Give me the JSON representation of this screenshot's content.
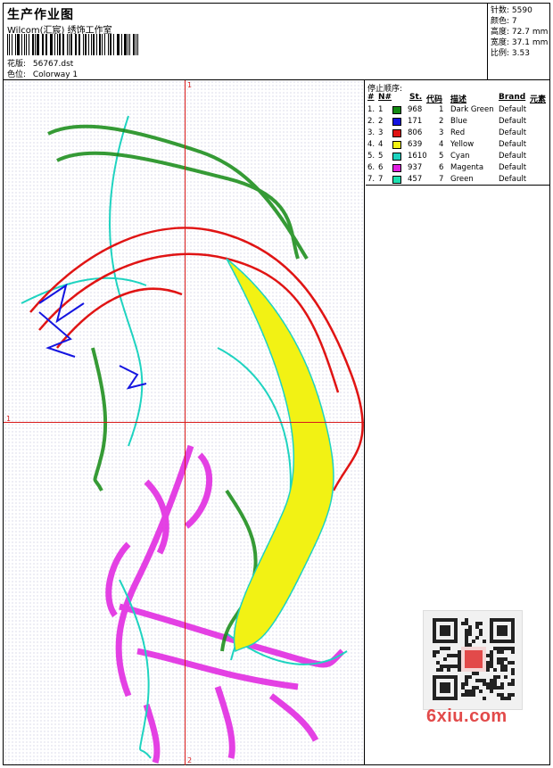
{
  "header": {
    "title": "生产作业图",
    "studio": "Wilcom(汇宸) 绣饰工作室",
    "design_label": "花版:",
    "design_value": "56767.dst",
    "colorway_label": "色位:",
    "colorway_value": "Colorway 1"
  },
  "stats": [
    {
      "label": "针数:",
      "value": "5590"
    },
    {
      "label": "颜色:",
      "value": "7"
    },
    {
      "label": "高度:",
      "value": "72.7 mm"
    },
    {
      "label": "宽度:",
      "value": "37.1 mm"
    },
    {
      "label": "比例:",
      "value": "3.53"
    }
  ],
  "canvas": {
    "axis_top": "1",
    "axis_left": "1",
    "axis_bottom": "2"
  },
  "stop_sequence": {
    "title": "停止顺序:",
    "columns": [
      "#",
      "N#",
      "St.",
      "代码",
      "描述",
      "Brand",
      "元素"
    ],
    "rows": [
      {
        "num": "1.",
        "n": "1",
        "st": "968",
        "code": "1",
        "desc": "Dark Green",
        "brand": "Default",
        "color": "#138a13"
      },
      {
        "num": "2.",
        "n": "2",
        "st": "171",
        "code": "2",
        "desc": "Blue",
        "brand": "Default",
        "color": "#1414e0"
      },
      {
        "num": "3.",
        "n": "3",
        "st": "806",
        "code": "3",
        "desc": "Red",
        "brand": "Default",
        "color": "#e01414"
      },
      {
        "num": "4.",
        "n": "4",
        "st": "639",
        "code": "4",
        "desc": "Yellow",
        "brand": "Default",
        "color": "#f2f214"
      },
      {
        "num": "5.",
        "n": "5",
        "st": "1610",
        "code": "5",
        "desc": "Cyan",
        "brand": "Default",
        "color": "#1ed3c0"
      },
      {
        "num": "6.",
        "n": "6",
        "st": "937",
        "code": "6",
        "desc": "Magenta",
        "brand": "Default",
        "color": "#e020e0"
      },
      {
        "num": "7.",
        "n": "7",
        "st": "457",
        "code": "7",
        "desc": "Green",
        "brand": "Default",
        "color": "#1ee0b0"
      }
    ]
  },
  "watermark": "6xiu.com",
  "icons": {
    "qr": "qr-code-icon"
  }
}
